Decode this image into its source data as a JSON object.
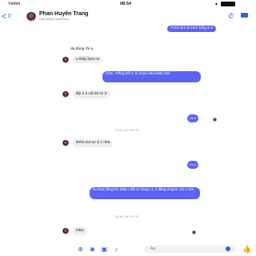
{
  "status_bar": {
    "carrier": "Viettel",
    "time": "08:54"
  },
  "header": {
    "back_glyph": "<",
    "unread_count": "0",
    "contact_name": "Phan Huyền Trang",
    "active_status": "Hoạt động 5 phút trước",
    "call_icon": "phone-icon",
    "video_icon": "video-icon"
  },
  "messages": [
    {
      "side": "out",
      "text": "Form hm to hơn bthg e a"
    },
    {
      "side": "in",
      "text": "dạ đúng rồi ạ"
    },
    {
      "side": "in",
      "text": "e thấy form to"
    },
    {
      "side": "out",
      "text": "Uhm. Trắng hết s. E chọn màu khác nhé"
    },
    {
      "side": "in",
      "text": "lấy e 1 cái s6 sz S"
    },
    {
      "side": "out",
      "text": "Ok e"
    },
    {
      "side": "in",
      "text": "thêm 8,9 sz S c nha"
    },
    {
      "side": "out",
      "text": "Ok e"
    },
    {
      "side": "out",
      "text": "áo thun hồng kid 185k c đặt có hàng r a, e đăng shopee cho c nhé"
    },
    {
      "side": "in",
      "text": "Okie"
    }
  ],
  "timestamps": [
    "11:43, 25 THG 11",
    "20:36, 28 THG 11"
  ],
  "composer": {
    "placeholder": "Aa",
    "icons": [
      "grid-icon",
      "camera-icon",
      "image-icon",
      "mic-icon",
      "emoji-icon",
      "thumbs-up-icon"
    ]
  },
  "colors": {
    "accent": "#5b64f2",
    "icon_blue": "#3b5bf0",
    "incoming_bubble": "#eeeeee"
  }
}
